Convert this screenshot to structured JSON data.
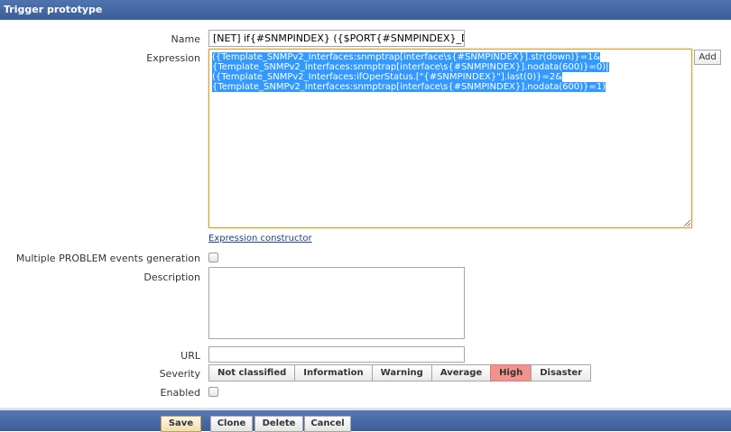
{
  "title": "Trigger prototype",
  "form": {
    "name_label": "Name",
    "name_value": "[NET] if{#SNMPINDEX} ({$PORT{#SNMPINDEX}_DESC}) is",
    "expression_label": "Expression",
    "expression_lines": [
      "({Template_SNMPv2_Interfaces:snmptrap[interface\\s{#SNMPINDEX}].str(down)}=1&",
      "{Template_SNMPv2_Interfaces:snmptrap[interface\\s{#SNMPINDEX}].nodata(600)}=0)|",
      "({Template_SNMPv2_Interfaces:ifOperStatus.[\"{#SNMPINDEX}\"].last(0)}=2&",
      "{Template_SNMPv2_Interfaces:snmptrap[interface\\s{#SNMPINDEX}].nodata(600)}=1)"
    ],
    "add_button": "Add",
    "expression_constructor_link": "Expression constructor",
    "multiple_problem_label": "Multiple PROBLEM events generation",
    "multiple_problem_checked": false,
    "description_label": "Description",
    "description_value": "",
    "url_label": "URL",
    "url_value": "",
    "severity_label": "Severity",
    "severity_options": [
      "Not classified",
      "Information",
      "Warning",
      "Average",
      "High",
      "Disaster"
    ],
    "severity_selected": "High",
    "enabled_label": "Enabled",
    "enabled_checked": false
  },
  "footer": {
    "save": "Save",
    "clone": "Clone",
    "delete": "Delete",
    "cancel": "Cancel"
  },
  "colors": {
    "header_blue": "#3c5f98",
    "selection_blue": "#3399ff",
    "severity_high": "#f0938f"
  }
}
